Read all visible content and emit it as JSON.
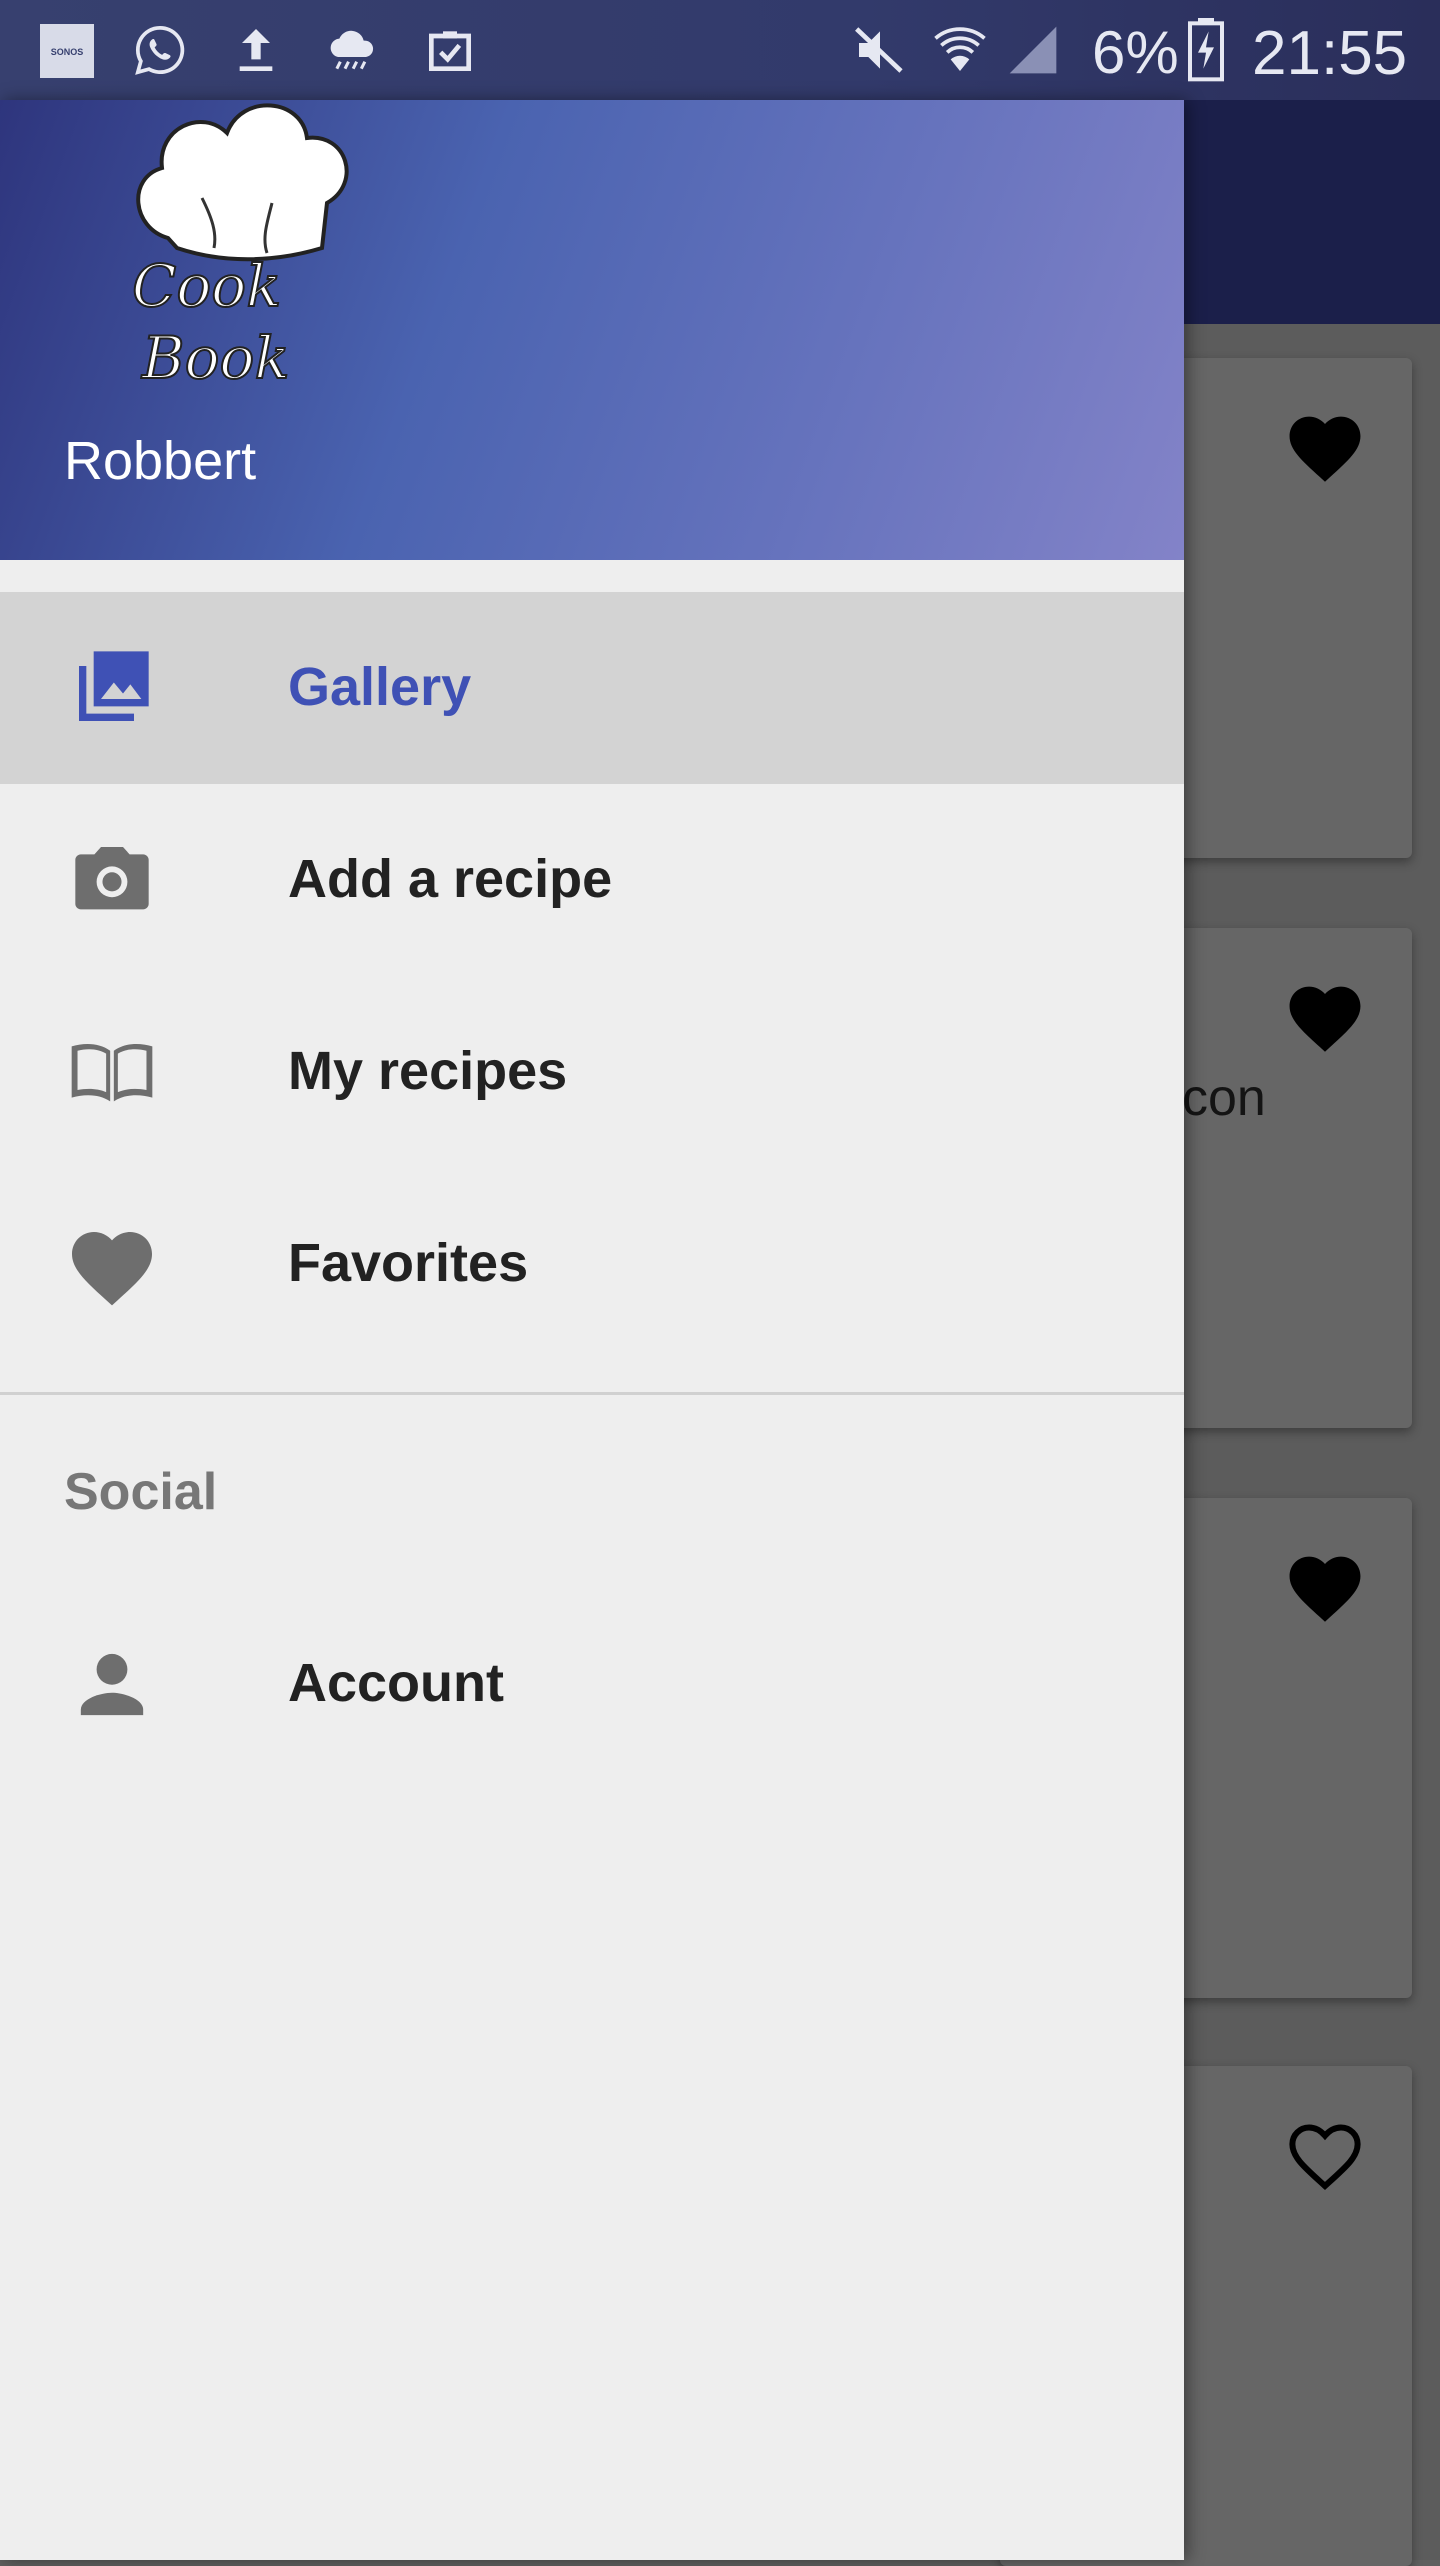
{
  "status_bar": {
    "icons": [
      "sonos-icon",
      "whatsapp-icon",
      "upload-icon",
      "weather-icon",
      "clipboard-check-icon",
      "mute-icon",
      "wifi-icon",
      "signal-icon",
      "battery-charging-icon"
    ],
    "sonos_text": "SONOS",
    "battery_percent": "6%",
    "time": "21:55"
  },
  "drawer": {
    "header": {
      "logo_text_line1": "Cook",
      "logo_text_line2": "Book",
      "user_name": "Robbert"
    },
    "items": [
      {
        "label": "Gallery",
        "icon": "gallery-icon",
        "selected": true
      },
      {
        "label": "Add a recipe",
        "icon": "camera-icon",
        "selected": false
      },
      {
        "label": "My recipes",
        "icon": "book-icon",
        "selected": false
      },
      {
        "label": "Favorites",
        "icon": "heart-icon",
        "selected": false
      }
    ],
    "section_label": "Social",
    "social_items": [
      {
        "label": "Account",
        "icon": "person-icon"
      }
    ]
  },
  "background_cards": [
    {
      "text": "",
      "favorite": true
    },
    {
      "text": "con",
      "favorite": true
    },
    {
      "text": "",
      "favorite": true
    },
    {
      "text": "",
      "favorite": false
    }
  ],
  "colors": {
    "accent": "#3f51b5",
    "header_start": "#2e357d",
    "header_end": "#8383c8",
    "selected_bg": "#d3d3d3",
    "drawer_bg": "#eeeeee"
  }
}
